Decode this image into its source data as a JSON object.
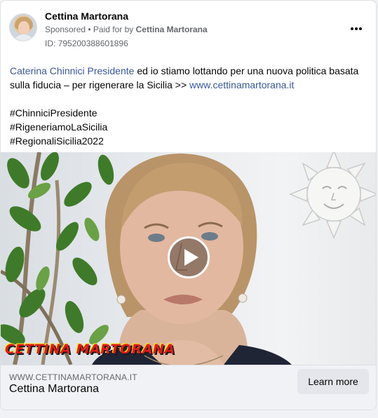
{
  "post": {
    "page_name": "Cettina Martorana",
    "sponsored_label": "Sponsored",
    "separator": " • ",
    "paid_for_prefix": "Paid for by ",
    "paid_for_name": "Cettina Martorana",
    "ad_id": "ID: 795200388601896",
    "more_icon": "more-horizontal-icon"
  },
  "body": {
    "link_1": "Caterina Chinnici Presidente",
    "text_1": " ed io stiamo lottando per una nuova politica basata sulla fiducia – per rigenerare la Sicilia >> ",
    "link_2": "www.cettinamartorana.it",
    "hashtags": [
      "#ChinniciPresidente",
      "#RigeneriamoLaSicilia",
      "#RegionaliSicilia2022"
    ]
  },
  "media": {
    "type": "video",
    "play_icon": "play-icon",
    "watermark": "CETTINA MARTORANA"
  },
  "footer": {
    "domain": "WWW.CETTINAMARTORANA.IT",
    "title": "Cettina Martorana",
    "cta_label": "Learn more"
  },
  "colors": {
    "link": "#385898",
    "secondary_text": "#65676b",
    "footer_bg": "#f0f2f5",
    "button_bg": "#e4e6eb"
  }
}
